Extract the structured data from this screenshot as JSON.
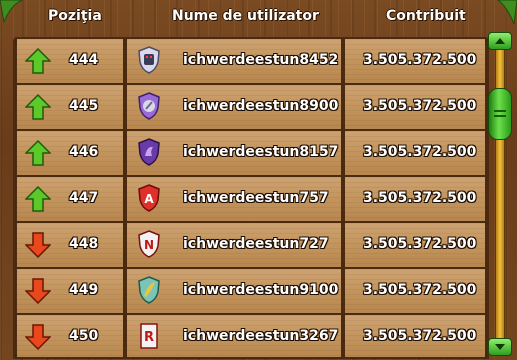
{
  "header": {
    "col_position": "Poziţia",
    "col_username": "Nume de utilizator",
    "col_contribution": "Contribuit"
  },
  "rows": [
    {
      "position": "444",
      "username": "ichwerdeestun8452",
      "contribution": "3.505.372.500",
      "trend": "up",
      "badge_icon": "shield-robot-icon"
    },
    {
      "position": "445",
      "username": "ichwerdeestun8900",
      "contribution": "3.505.372.500",
      "trend": "up",
      "badge_icon": "shield-purple-emblem-icon"
    },
    {
      "position": "446",
      "username": "ichwerdeestun8157",
      "contribution": "3.505.372.500",
      "trend": "up",
      "badge_icon": "shield-purple-dragon-icon"
    },
    {
      "position": "447",
      "username": "ichwerdeestun757",
      "contribution": "3.505.372.500",
      "trend": "up",
      "badge_icon": "shield-letter-a-icon"
    },
    {
      "position": "448",
      "username": "ichwerdeestun727",
      "contribution": "3.505.372.500",
      "trend": "down",
      "badge_icon": "shield-letter-n-icon"
    },
    {
      "position": "449",
      "username": "ichwerdeestun9100",
      "contribution": "3.505.372.500",
      "trend": "down",
      "badge_icon": "shield-green-feather-icon"
    },
    {
      "position": "450",
      "username": "ichwerdeestun3267",
      "contribution": "3.505.372.500",
      "trend": "down",
      "badge_icon": "shield-letter-r-icon"
    }
  ],
  "colors": {
    "up_arrow": "#5cc92a",
    "down_arrow": "#e8481c",
    "scrollbar": "#4cc73a"
  }
}
